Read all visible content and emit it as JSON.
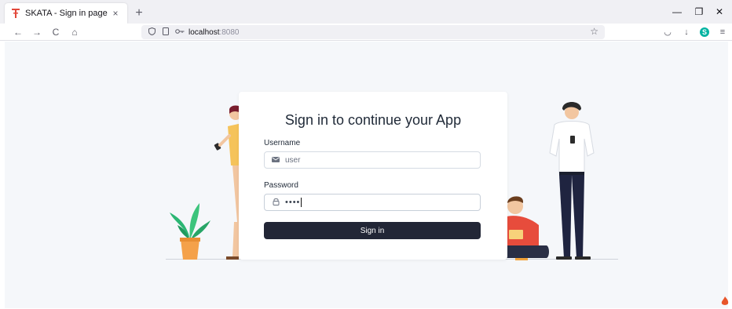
{
  "browser": {
    "tab": {
      "title": "SKATA - Sign in page",
      "close": "×"
    },
    "new_tab": "+",
    "window": {
      "minimize": "—",
      "restore": "❐",
      "close": "✕"
    },
    "nav": {
      "back": "←",
      "forward": "→",
      "reload": "C",
      "home": "⌂"
    },
    "url": {
      "host": "localhost",
      "port": ":8080"
    },
    "toolbar": {
      "pocket": "◡",
      "downloads": "↓",
      "account": "S",
      "menu": "≡"
    }
  },
  "signin": {
    "heading": "Sign in to continue your App",
    "username_label": "Username",
    "username_value": "user",
    "password_label": "Password",
    "password_value": "••••",
    "button_label": "Sign in"
  },
  "colors": {
    "button": "#222636",
    "background": "#f5f7fa",
    "accent_shirt": "#e74c3c"
  }
}
